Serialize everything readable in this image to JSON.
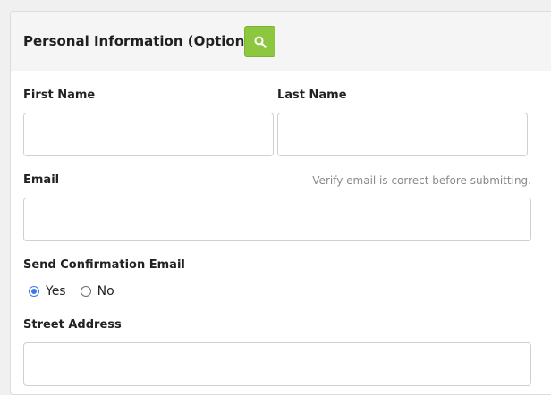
{
  "section": {
    "title": "Personal Information (Optional)",
    "search_icon": "search-icon",
    "accent_color": "#8dc63f"
  },
  "fields": {
    "first_name": {
      "label": "First Name",
      "value": ""
    },
    "last_name": {
      "label": "Last Name",
      "value": ""
    },
    "email": {
      "label": "Email",
      "hint": "Verify email is correct before submitting.",
      "value": ""
    },
    "send_confirmation": {
      "label": "Send Confirmation Email",
      "options": [
        "Yes",
        "No"
      ],
      "selected": "Yes"
    },
    "street_address": {
      "label": "Street Address",
      "value": ""
    }
  }
}
